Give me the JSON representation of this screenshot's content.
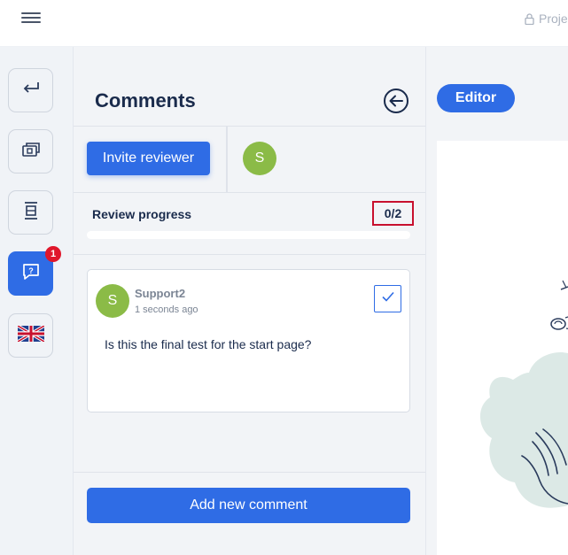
{
  "topbar": {
    "menu_icon": "hamburger-icon",
    "project_label": "Proje",
    "lock_icon": "lock-icon"
  },
  "rail": {
    "items": [
      {
        "icon": "return-arrow-icon"
      },
      {
        "icon": "preview-card-icon"
      },
      {
        "icon": "layout-frame-icon"
      },
      {
        "icon": "comment-question-icon",
        "badge": "1",
        "active": true
      },
      {
        "icon": "uk-flag-icon"
      }
    ]
  },
  "panel": {
    "title": "Comments",
    "collapse_icon": "arrow-left-circle-icon",
    "invite_label": "Invite reviewer",
    "reviewer_initial": "S",
    "progress_label": "Review progress",
    "progress_count": "0/2",
    "progress_fraction": 0,
    "comment": {
      "avatar_initial": "S",
      "author": "Support2",
      "time": "1 seconds ago",
      "text": "Is this the final test for the start page?",
      "check_icon": "checkmark-icon"
    },
    "add_label": "Add new comment"
  },
  "editor": {
    "tab_label": "Editor"
  },
  "colors": {
    "accent": "#2f6ce5",
    "avatar": "#8bbb47",
    "badge": "#e0162b",
    "highlight_border": "#c8102e"
  }
}
